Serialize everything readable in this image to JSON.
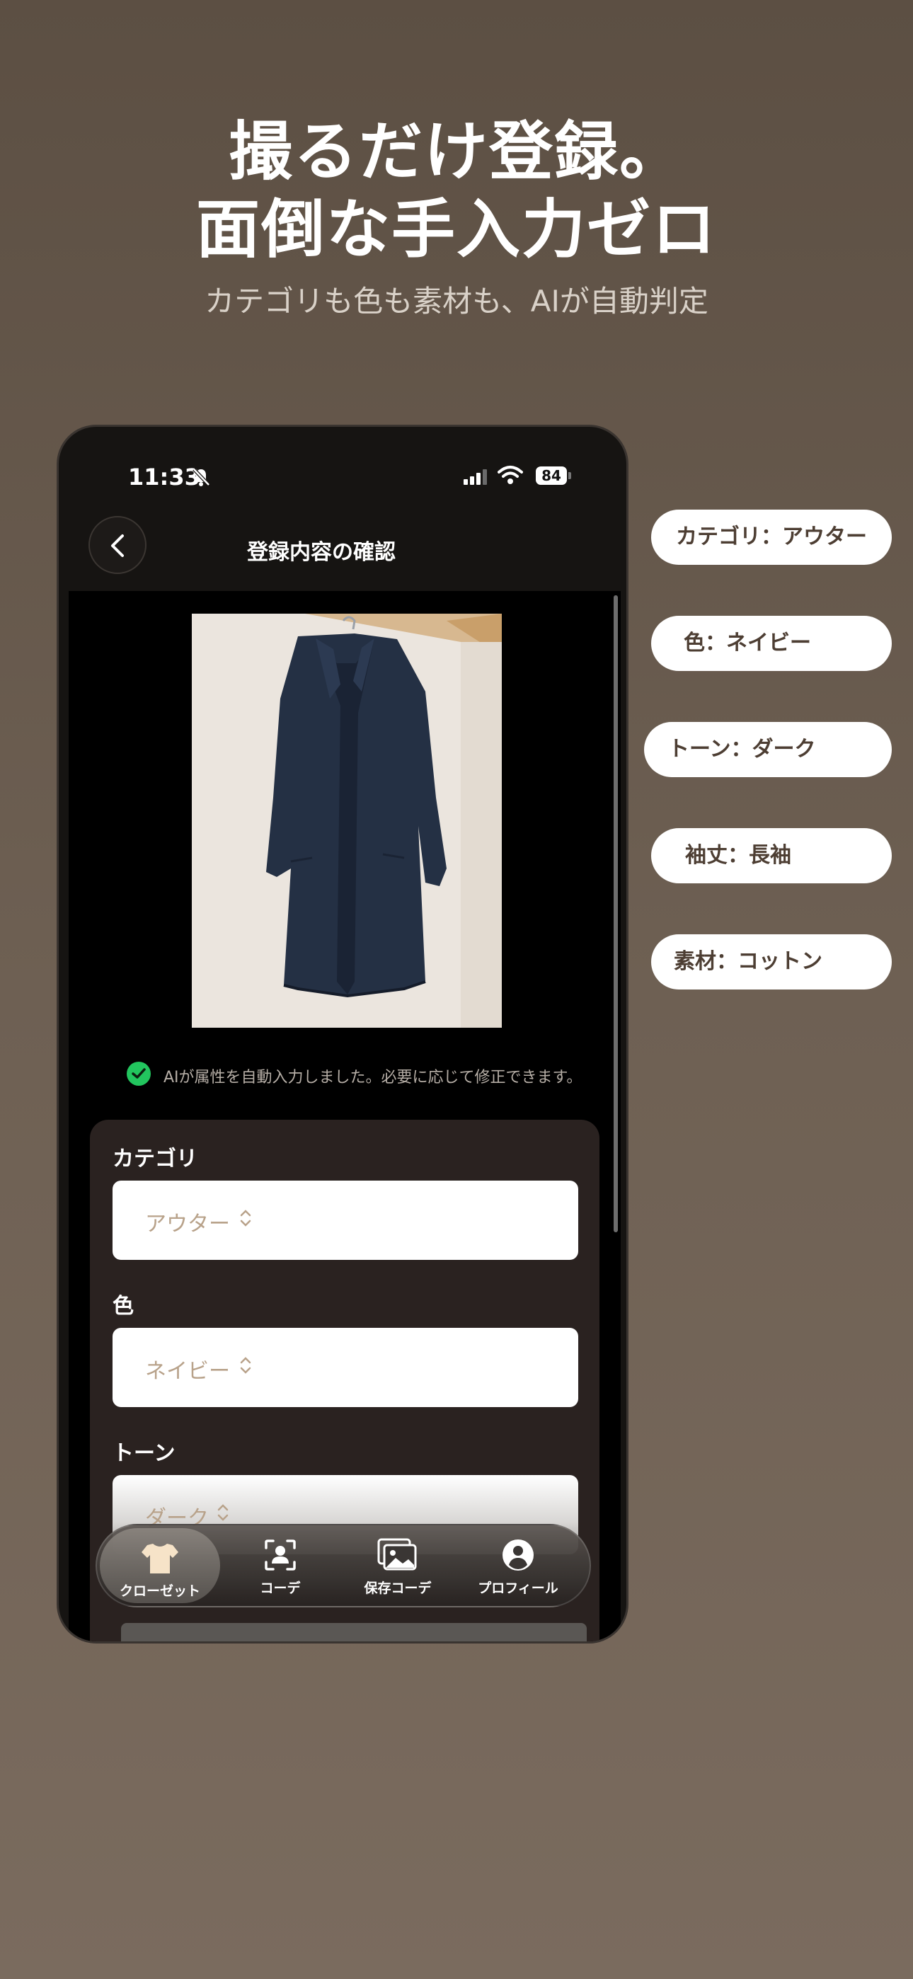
{
  "headline": {
    "line1": "撮るだけ登録。",
    "line2": "面倒な手入力ゼロ",
    "subtitle": "カテゴリも色も素材も、AIが自動判定"
  },
  "status_bar": {
    "time": "11:33",
    "battery": "84"
  },
  "nav": {
    "title": "登録内容の確認"
  },
  "ai_note": "AIが属性を自動入力しました。必要に応じて修正できます。",
  "form": {
    "fields": [
      {
        "label": "カテゴリ",
        "value": "アウター"
      },
      {
        "label": "色",
        "value": "ネイビー"
      },
      {
        "label": "トーン",
        "value": "ダーク"
      }
    ]
  },
  "tabbar": {
    "tabs": [
      {
        "label": "クローゼット",
        "icon": "tshirt-icon",
        "active": true
      },
      {
        "label": "コーデ",
        "icon": "person-scan-icon",
        "active": false
      },
      {
        "label": "保存コーデ",
        "icon": "photos-icon",
        "active": false
      },
      {
        "label": "プロフィール",
        "icon": "profile-icon",
        "active": false
      }
    ]
  },
  "chips": [
    "カテゴリ：アウター",
    "色：ネイビー",
    "トーン：ダーク",
    "袖丈：長袖",
    "素材：コットン"
  ],
  "colors": {
    "background": "#6e6053",
    "check_green": "#22c55e",
    "field_value": "#b8a28a",
    "card": "#2a2220",
    "chip_text": "#4d3e33"
  }
}
